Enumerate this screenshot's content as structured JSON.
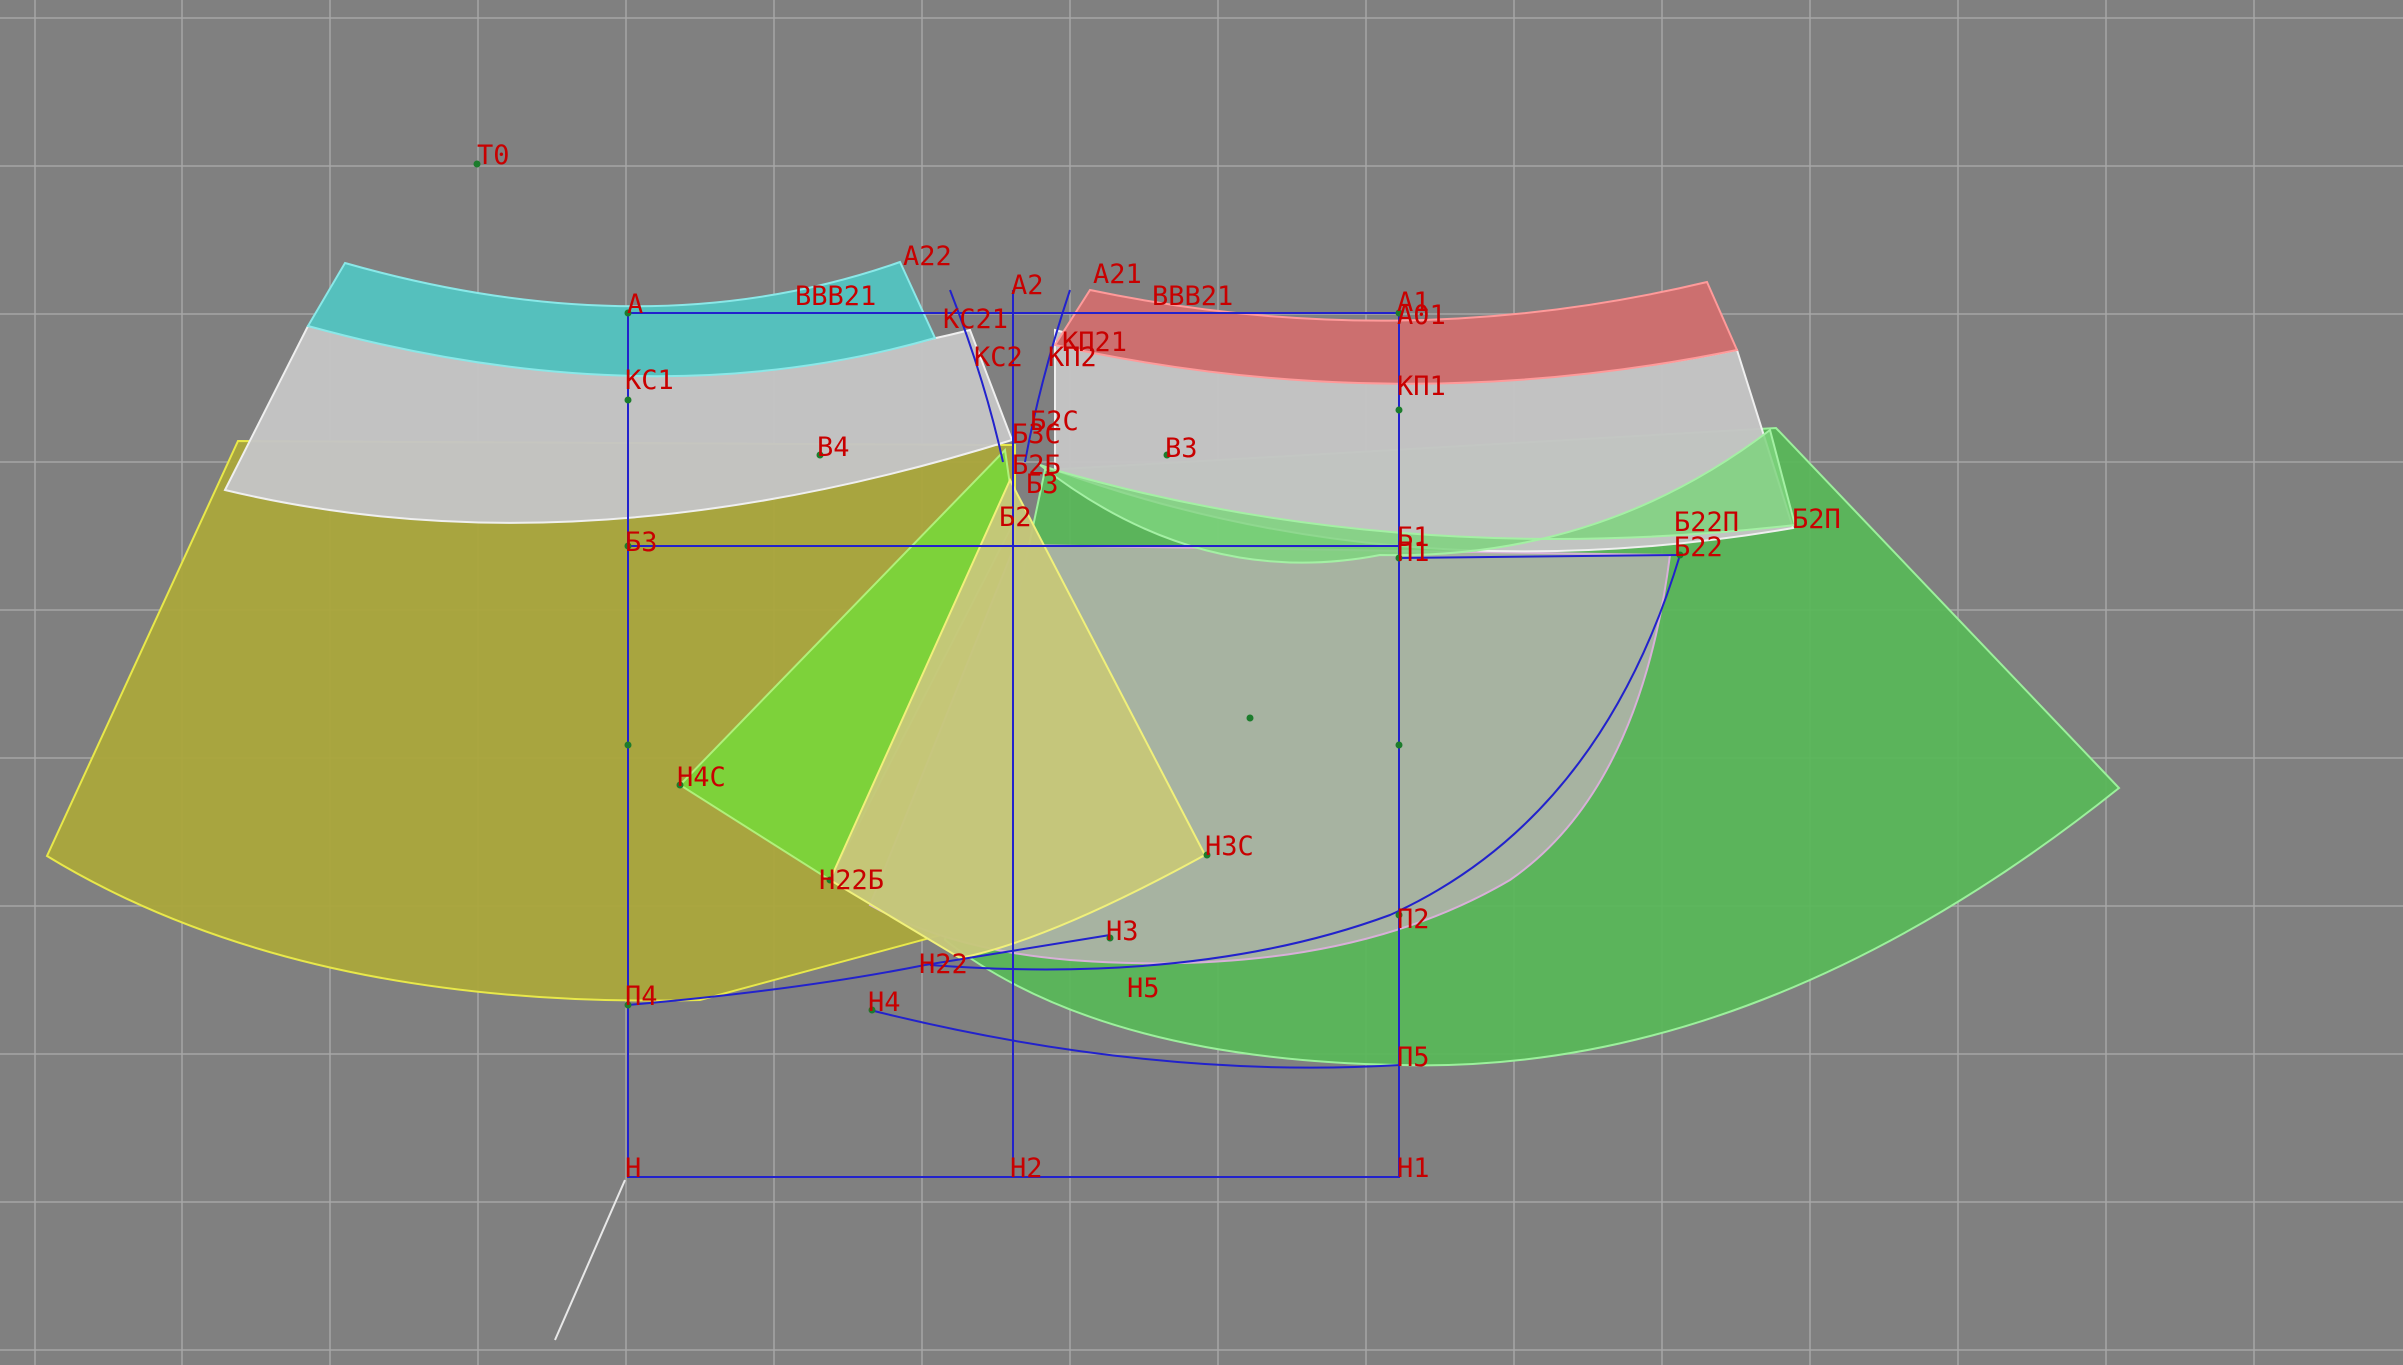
{
  "colors": {
    "background": "#808080",
    "grid": "#a6a6a6",
    "construction_line": "#2222cc",
    "label": "#c80000",
    "piece_cyan": "#55c0bd",
    "piece_red": "#cc6f6f",
    "piece_light": "#c4c4c4",
    "piece_yellow": "#aaa73c",
    "piece_yellow_light": "#c6c77a",
    "piece_green": "#58b858",
    "piece_green_bright": "#7ad43a",
    "piece_pale": "#a9b3a3"
  },
  "labels": {
    "t0": "Т0",
    "a": "А",
    "a1": "А1",
    "a2": "А2",
    "a21": "А21",
    "a22": "А22",
    "a01": "А01",
    "vvv21": "ВВВ21",
    "vvv21_right": "ВВВ21",
    "ks21": "КС21",
    "ks2": "КС2",
    "kp21": "КП21",
    "kp2": "КП2",
    "ks1": "КС1",
    "kp1": "КП1",
    "v4": "В4",
    "v3": "В3",
    "b2s": "Б2С",
    "b3s": "Б3С",
    "b2b": "Б2Б",
    "b3_center": "Б3",
    "b2": "Б2",
    "b3": "Б3",
    "b1": "Б1",
    "p1": "П1",
    "b22p": "Б22П",
    "b22": "Б22",
    "b2p": "Б2П",
    "n4s": "Н4С",
    "n3s": "Н3С",
    "n22b": "Н22Б",
    "n3": "Н3",
    "n22": "Н22",
    "n5": "Н5",
    "p2": "П2",
    "n4": "Н4",
    "p4": "П4",
    "p5": "П5",
    "n": "Н",
    "n2": "Н2",
    "n1": "Н1"
  }
}
